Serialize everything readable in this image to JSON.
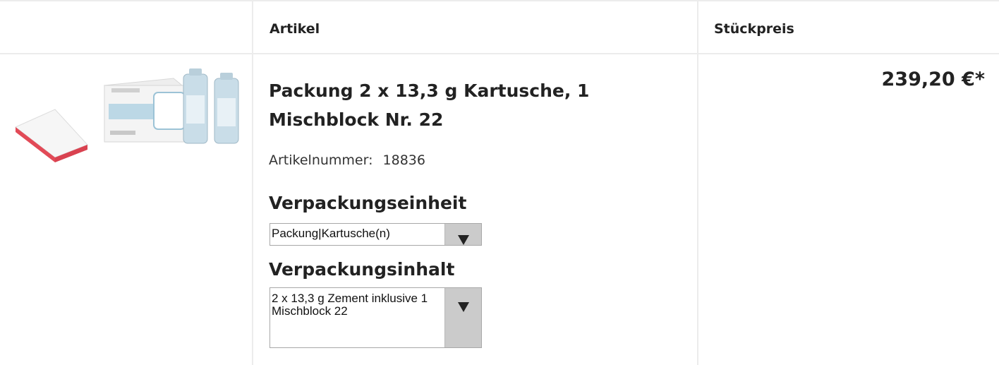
{
  "table": {
    "header": {
      "article_label": "Artikel",
      "unit_price_label": "Stückpreis"
    }
  },
  "product": {
    "image_alt": "Produktbild",
    "title": "Packung 2 x 13,3 g Kartusche, 1 Mischblock Nr. 22",
    "article_number_label": "Artikelnummer:",
    "article_number": "18836",
    "packaging_unit_label": "Verpackungseinheit",
    "packaging_unit_value": "Packung|Kartusche(n)",
    "packaging_content_label": "Verpackungsinhalt",
    "packaging_content_value": "2 x 13,3 g Zement inklusive 1 Mischblock 22",
    "price": "239,20 €*"
  },
  "colors": {
    "accent_pad_edge": "#e24a57",
    "box_blue": "#9cc3d6",
    "select_button": "#cbcbcb"
  }
}
